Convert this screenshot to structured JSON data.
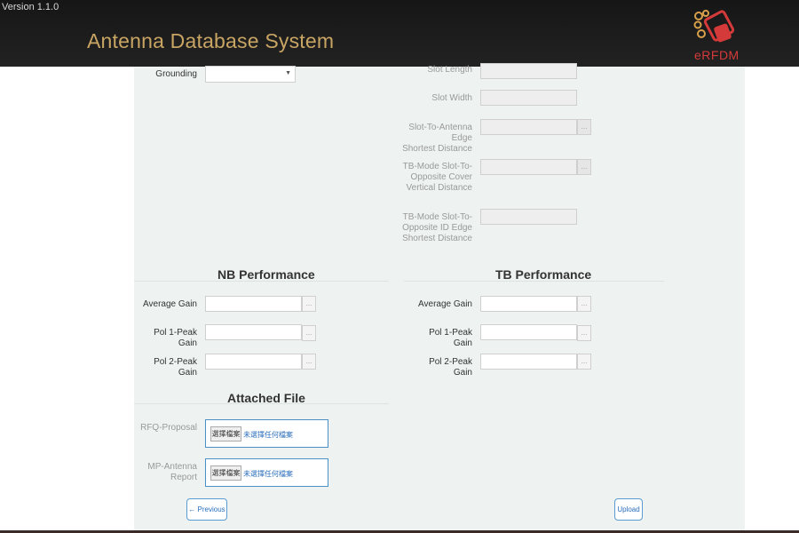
{
  "header": {
    "version": "Version 1.1.0",
    "app_title": "Antenna Database System",
    "logo_text": "eRFDM"
  },
  "form": {
    "grounding_label": "Grounding",
    "grounding_value": "",
    "slot_length_label": "Slot Length",
    "slot_width_label": "Slot Width",
    "slot_edge_label_1": "Slot-To-Antenna Edge",
    "slot_edge_label_2": "Shortest Distance",
    "tb_cover_label_1": "TB-Mode Slot-To-",
    "tb_cover_label_2": "Opposite Cover",
    "tb_cover_label_3": "Vertical Distance",
    "tb_id_label_1": "TB-Mode Slot-To-",
    "tb_id_label_2": "Opposite ID Edge",
    "tb_id_label_3": "Shortest Distance",
    "spin_glyph": "..."
  },
  "nb": {
    "title": "NB Performance",
    "average_gain": "Average Gain",
    "pol1": "Pol 1-Peak Gain",
    "pol2": "Pol 2-Peak Gain"
  },
  "tb": {
    "title": "TB Performance",
    "average_gain": "Average Gain",
    "pol1": "Pol 1-Peak Gain",
    "pol2": "Pol 2-Peak Gain"
  },
  "attached": {
    "title": "Attached File",
    "rfq_label": "RFQ-Proposal",
    "mp_label": "MP-Antenna Report",
    "choose_button": "選擇檔案",
    "no_file": "未選擇任何檔案"
  },
  "actions": {
    "previous": "← Previous",
    "upload": "Upload"
  }
}
